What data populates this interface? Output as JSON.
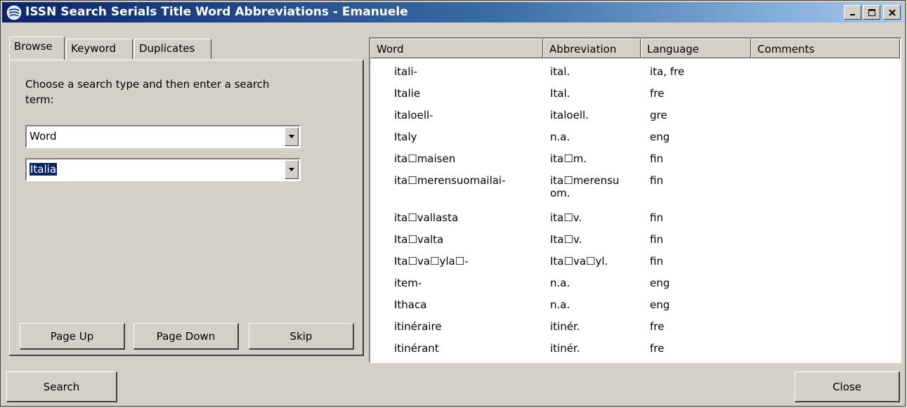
{
  "window": {
    "title": "ISSN Search Serials Title Word Abbreviations - Emanuele",
    "controls": [
      "minimize",
      "maximize",
      "close"
    ]
  },
  "tabs": [
    {
      "label": "Browse",
      "active": true
    },
    {
      "label": "Keyword",
      "active": false
    },
    {
      "label": "Duplicates",
      "active": false
    }
  ],
  "browse": {
    "instruction": "Choose a search type and then enter a search term:",
    "search_type": "Word",
    "search_term": "Italia",
    "page_up_label": "Page Up",
    "page_down_label": "Page Down",
    "skip_label": "Skip"
  },
  "table": {
    "columns": [
      "Word",
      "Abbreviation",
      "Language",
      "Comments"
    ],
    "rows": [
      {
        "word": "itali-",
        "abbr": "ital.",
        "lang": "ita, fre",
        "comments": ""
      },
      {
        "word": "Italie",
        "abbr": "Ital.",
        "lang": "fre",
        "comments": ""
      },
      {
        "word": "italoell-",
        "abbr": "italoell.",
        "lang": "gre",
        "comments": ""
      },
      {
        "word": "Italy",
        "abbr": "n.a.",
        "lang": "eng",
        "comments": ""
      },
      {
        "word": "ita☐maisen",
        "abbr": "ita☐m.",
        "lang": "fin",
        "comments": ""
      },
      {
        "word": "ita☐merensuomailai-",
        "abbr": "ita☐merensu\nom.",
        "lang": "fin",
        "comments": ""
      },
      {
        "word": "ita☐vallasta",
        "abbr": "ita☐v.",
        "lang": "fin",
        "comments": ""
      },
      {
        "word": "Ita☐valta",
        "abbr": "Ita☐v.",
        "lang": "fin",
        "comments": ""
      },
      {
        "word": "Ita☐va☐yla☐-",
        "abbr": "Ita☐va☐yl.",
        "lang": "fin",
        "comments": ""
      },
      {
        "word": "item-",
        "abbr": "n.a.",
        "lang": "eng",
        "comments": ""
      },
      {
        "word": "Ithaca",
        "abbr": "n.a.",
        "lang": "eng",
        "comments": ""
      },
      {
        "word": "itinéraire",
        "abbr": "itinér.",
        "lang": "fre",
        "comments": ""
      },
      {
        "word": "itinérant",
        "abbr": "itinér.",
        "lang": "fre",
        "comments": ""
      }
    ]
  },
  "footer": {
    "search_label": "Search",
    "close_label": "Close"
  }
}
